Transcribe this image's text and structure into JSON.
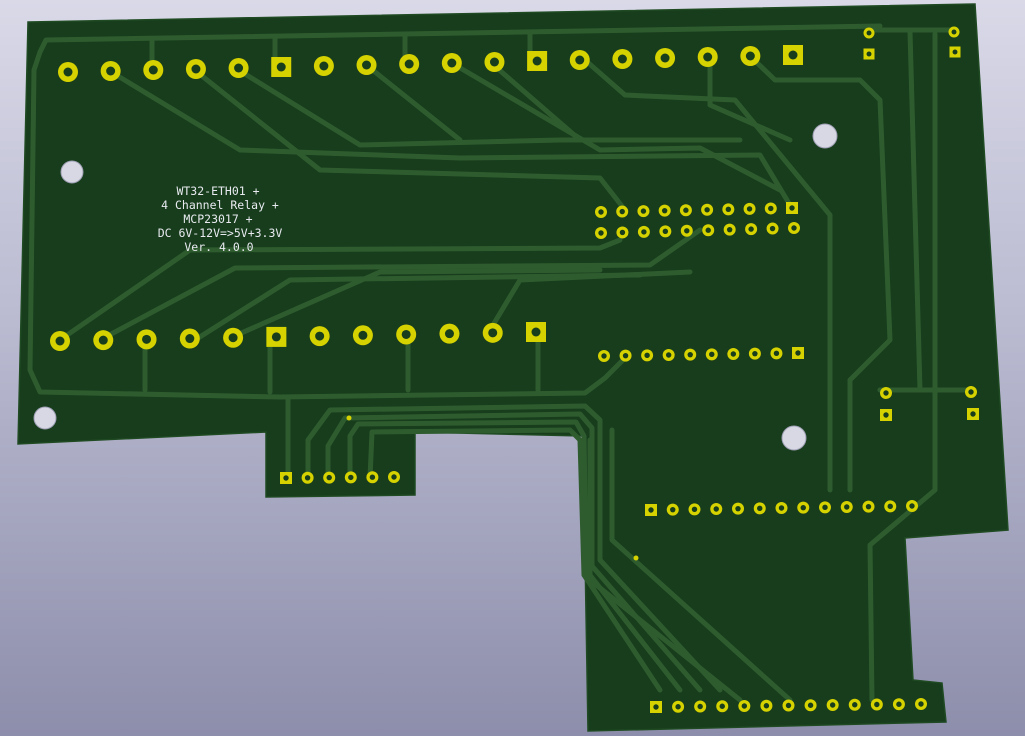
{
  "board": {
    "silkscreen_lines": [
      "WT32-ETH01 +",
      "4 Channel Relay +",
      "MCP23017 +",
      "DC 6V-12V=>5V+3.3V",
      "Ver. 4.0.0"
    ]
  },
  "colors": {
    "background_top": "#d9d9e8",
    "background_bottom": "#8d8eab",
    "board": "#173d1c",
    "trace": "#2f5c2f",
    "copper": "#d6d200",
    "silkscreen": "#e8eaf0"
  }
}
